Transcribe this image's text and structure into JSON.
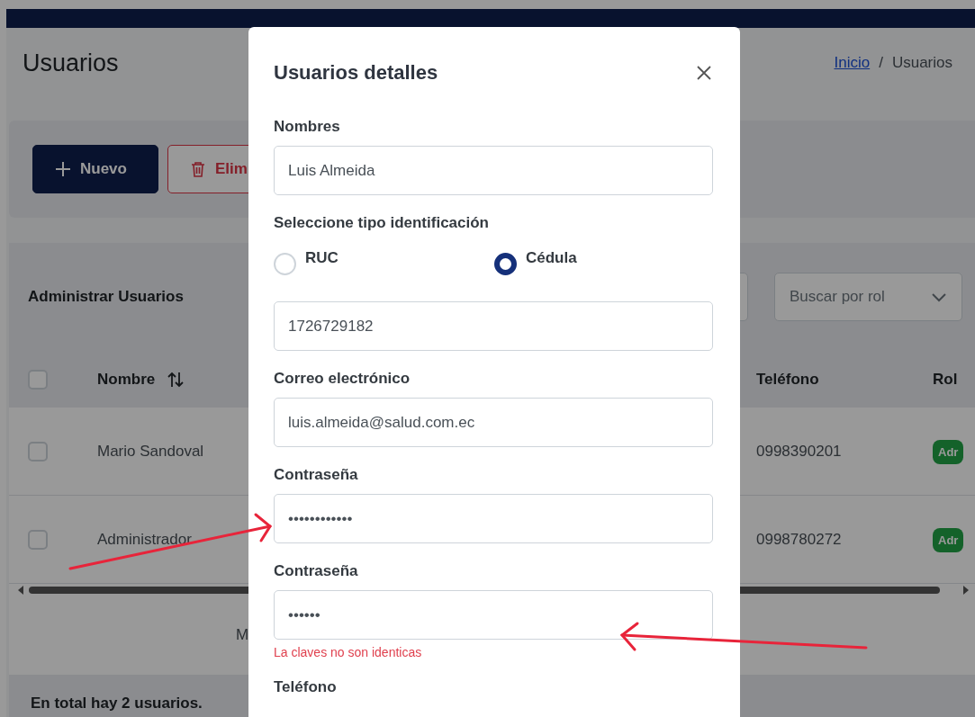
{
  "page": {
    "title": "Usuarios",
    "breadcrumb_separator": "/",
    "breadcrumb": [
      {
        "label": "Inicio",
        "kind": "link"
      },
      {
        "label": "Usuarios",
        "kind": "current"
      }
    ]
  },
  "toolbar": {
    "buttons": [
      {
        "label": "Nuevo",
        "kind": "primary"
      },
      {
        "label": "Elim",
        "kind": "danger"
      }
    ]
  },
  "table": {
    "title": "Administrar Usuarios",
    "role_filter": {
      "placeholder": "Buscar por rol"
    },
    "header_checkbox": {
      "checked": false
    },
    "columns": [
      {
        "label": "Nombre",
        "sortable": true
      },
      {
        "label": "Teléfono",
        "sortable": false
      },
      {
        "label": "Rol",
        "sortable": false
      }
    ],
    "rows": [
      {
        "checked": false,
        "name": "Mario Sandoval",
        "phone": "0998390201",
        "role": "Adr"
      },
      {
        "checked": false,
        "name": "Administrador",
        "phone": "0998780272",
        "role": "Adr"
      }
    ],
    "paginator_text": "M",
    "footer": "En total hay 2 usuarios."
  },
  "modal": {
    "title": "Usuarios detalles",
    "items": [
      {
        "kind": "field",
        "label": "Nombres",
        "value": "Luis Almeida"
      },
      {
        "kind": "radio-group",
        "label": "Seleccione tipo identificación",
        "options": [
          {
            "label": "RUC",
            "selected": false
          },
          {
            "label": "Cédula",
            "selected": true
          }
        ]
      },
      {
        "kind": "field",
        "value": "1726729182"
      },
      {
        "kind": "field",
        "label": "Correo electrónico",
        "value": "luis.almeida@salud.com.ec"
      },
      {
        "kind": "field",
        "label": "Contraseña",
        "value": "••••••••••••"
      },
      {
        "kind": "field",
        "label": "Contraseña",
        "value": "••••••",
        "error": "La claves no son identicas"
      },
      {
        "kind": "label",
        "label": "Teléfono"
      }
    ]
  }
}
